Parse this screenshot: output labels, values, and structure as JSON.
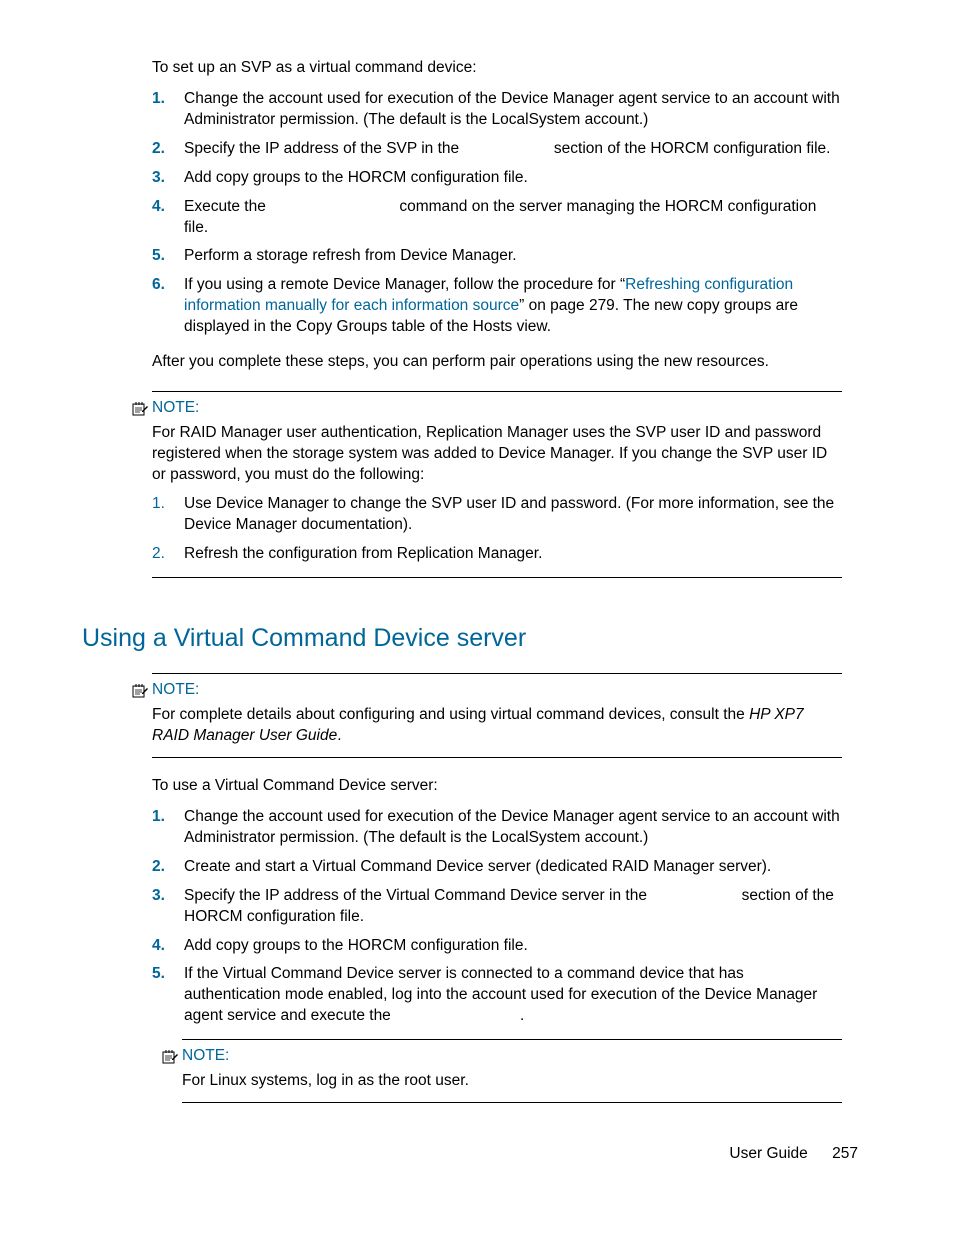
{
  "intro1": "To set up an SVP as a virtual command device:",
  "steps1": [
    "Change the account used for execution of the Device Manager agent service to an account with Administrator permission. (The default is the LocalSystem account.)",
    "Specify the IP address of the SVP in the                      section of the HORCM configuration file.",
    "Add copy groups to the HORCM configuration file.",
    "Execute the                               command on the server managing the HORCM configuration file.",
    "Perform a storage refresh from Device Manager."
  ],
  "step6_prefix": "If you using a remote Device Manager, follow the procedure for “",
  "step6_link": "Refreshing configuration information manually for each information source",
  "step6_suffix": "” on page 279. The new copy groups are displayed in the Copy Groups table of the Hosts view.",
  "after1": "After you complete these steps, you can perform pair operations using the new resources.",
  "note_label": "NOTE:",
  "note1_body": "For RAID Manager user authentication, Replication Manager uses the SVP user ID and password registered when the storage system was added to Device Manager. If you change the SVP user ID or password, you must do the following:",
  "note1_steps": [
    "Use Device Manager to change the SVP user ID and password. (For more information, see the Device Manager documentation).",
    "Refresh the configuration from Replication Manager."
  ],
  "heading2": "Using a Virtual Command Device server",
  "note2_prefix": "For complete details about configuring and using virtual command devices, consult the ",
  "note2_italic": "HP XP7 RAID Manager User Guide",
  "note2_suffix": ".",
  "intro2": "To use a Virtual Command Device server:",
  "steps2": [
    "Change the account used for execution of the Device Manager agent service to an account with Administrator permission. (The default is the LocalSystem account.)",
    "Create and start a Virtual Command Device server (dedicated RAID Manager server).",
    "Specify the IP address of the Virtual Command Device server in the                      section of the HORCM configuration file.",
    "Add copy groups to the HORCM configuration file.",
    "If the Virtual Command Device server is connected to a command device that has authentication mode enabled, log into the account used for execution of the Device Manager agent service and execute the                              ."
  ],
  "note3_body": "For Linux systems, log in as the root user.",
  "footer_label": "User Guide",
  "footer_page": "257"
}
